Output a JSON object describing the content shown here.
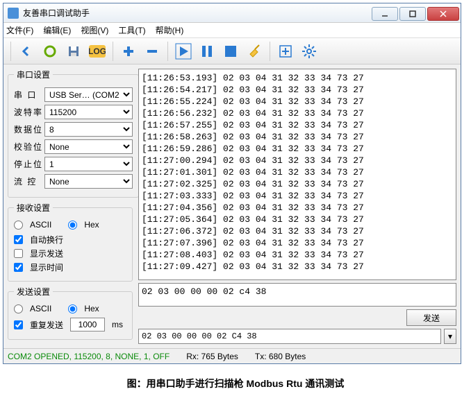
{
  "window": {
    "title": "友善串口调试助手"
  },
  "menu": {
    "file": "文件(F)",
    "edit": "编辑(E)",
    "view": "视图(V)",
    "tools": "工具(T)",
    "help": "帮助(H)"
  },
  "serial": {
    "legend": "串口设置",
    "port_label": "串 口",
    "port_value": "USB Ser… (COM2",
    "baud_label": "波特率",
    "baud_value": "115200",
    "data_label": "数据位",
    "data_value": "8",
    "check_label": "校验位",
    "check_value": "None",
    "stop_label": "停止位",
    "stop_value": "1",
    "flow_label": "流 控",
    "flow_value": "None"
  },
  "recv": {
    "legend": "接收设置",
    "ascii": "ASCII",
    "hex": "Hex",
    "autowrap": "自动换行",
    "showsend": "显示发送",
    "showtime": "显示时间"
  },
  "send": {
    "legend": "发送设置",
    "ascii": "ASCII",
    "hex": "Hex",
    "repeat": "重复发送",
    "interval": "1000",
    "ms": "ms",
    "button": "发送"
  },
  "rx_lines": [
    "[11:26:53.193] 02 03 04 31 32 33 34 73 27",
    "[11:26:54.217] 02 03 04 31 32 33 34 73 27",
    "[11:26:55.224] 02 03 04 31 32 33 34 73 27",
    "[11:26:56.232] 02 03 04 31 32 33 34 73 27",
    "[11:26:57.255] 02 03 04 31 32 33 34 73 27",
    "[11:26:58.263] 02 03 04 31 32 33 34 73 27",
    "[11:26:59.286] 02 03 04 31 32 33 34 73 27",
    "[11:27:00.294] 02 03 04 31 32 33 34 73 27",
    "[11:27:01.301] 02 03 04 31 32 33 34 73 27",
    "[11:27:02.325] 02 03 04 31 32 33 34 73 27",
    "[11:27:03.333] 02 03 04 31 32 33 34 73 27",
    "[11:27:04.356] 02 03 04 31 32 33 34 73 27",
    "[11:27:05.364] 02 03 04 31 32 33 34 73 27",
    "[11:27:06.372] 02 03 04 31 32 33 34 73 27",
    "[11:27:07.396] 02 03 04 31 32 33 34 73 27",
    "[11:27:08.403] 02 03 04 31 32 33 34 73 27",
    "[11:27:09.427] 02 03 04 31 32 33 34 73 27"
  ],
  "tx_text": "02 03 00 00 00 02 c4 38",
  "hex_input": "02 03 00 00 00 02 C4 38",
  "status": {
    "conn": "COM2 OPENED, 115200, 8, NONE, 1, OFF",
    "rx": "Rx: 765 Bytes",
    "tx": "Tx: 680 Bytes"
  },
  "caption": "图：用串口助手进行扫描枪 Modbus Rtu 通讯测试"
}
